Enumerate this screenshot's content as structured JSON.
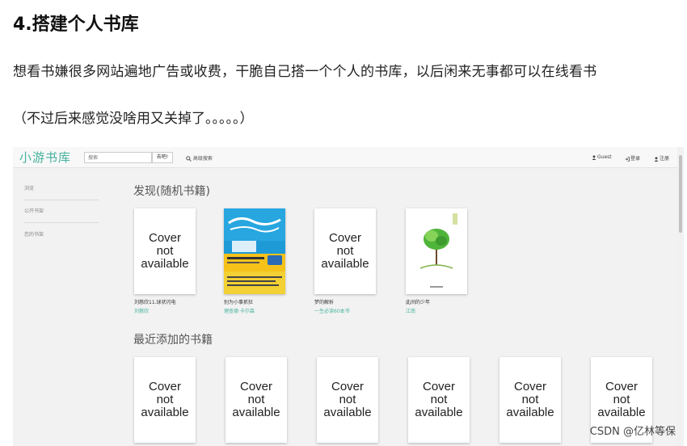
{
  "article": {
    "heading": "4.搭建个人书库",
    "paragraph": "想看书嫌很多网站遍地广告或收费，干脆自己搭一个个人的书库，以后闲来无事都可以在线看书",
    "note": "（不过后来感觉没啥用又关掉了。。。。。）"
  },
  "app": {
    "brand": "小游书库",
    "search_placeholder": "搜索",
    "search_button": "去吧!",
    "advanced_search": "高级搜索",
    "nav_right": {
      "guest": "Guest",
      "login": "登录",
      "register": "注册"
    },
    "sidebar": [
      {
        "label": "浏览"
      },
      {
        "label": "公开书架"
      },
      {
        "label": "您的书架"
      }
    ],
    "discover": {
      "title": "发现(随机书籍)",
      "books": [
        {
          "cover_text": [
            "Cover",
            "not",
            "available"
          ],
          "title": "刘慈欣11.球状闪电",
          "author": "刘慈欣"
        },
        {
          "cover_text": [],
          "title": "别为小事抓狂",
          "author": "理查德·卡尔森"
        },
        {
          "cover_text": [
            "Cover",
            "not",
            "available"
          ],
          "title": "梦的解析",
          "author": "一生必读60本书"
        },
        {
          "cover_text": [],
          "title": "此间的少年",
          "author": "江南"
        }
      ]
    },
    "recent": {
      "title": "最近添加的书籍",
      "books": [
        {
          "cover_text": [
            "Cover",
            "not",
            "available"
          ]
        },
        {
          "cover_text": [
            "Cover",
            "not",
            "available"
          ]
        },
        {
          "cover_text": [
            "Cover",
            "not",
            "available"
          ]
        },
        {
          "cover_text": [
            "Cover",
            "not",
            "available"
          ]
        },
        {
          "cover_text": [
            "Cover",
            "not",
            "available"
          ]
        },
        {
          "cover_text": [
            "Cover",
            "not",
            "available"
          ]
        }
      ]
    },
    "colors": {
      "accent": "#45b29d",
      "background": "#f2f2f2"
    }
  },
  "watermark": "CSDN @亿林等保"
}
